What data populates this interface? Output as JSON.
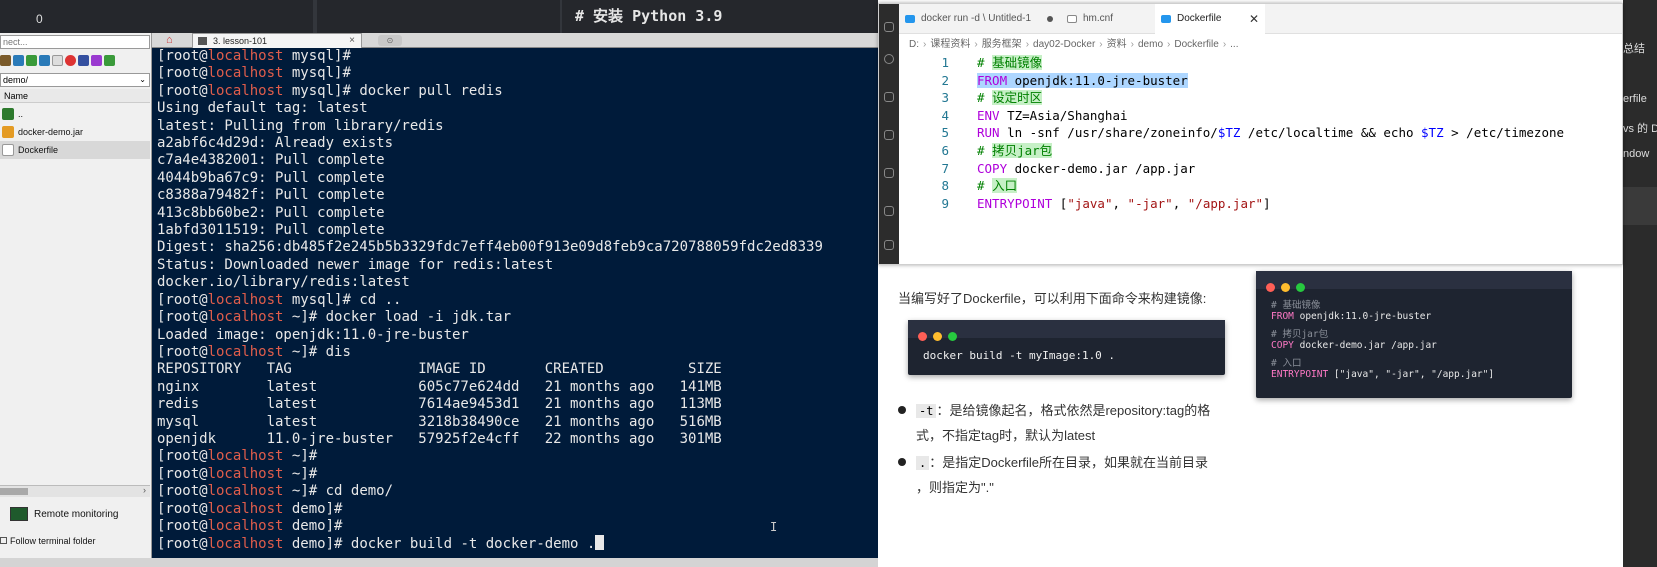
{
  "topbar": {
    "left_text": "0",
    "python_heading": "# 安装 Python 3.9"
  },
  "file_panel": {
    "search_placeholder": "nect...",
    "path": "demo/",
    "column_name": "Name",
    "files": [
      "..",
      "docker-demo.jar",
      "Dockerfile"
    ],
    "remote_monitoring": "Remote monitoring",
    "follow_terminal": "Follow terminal folder"
  },
  "terminal_tabs": {
    "tab_label": "3. lesson-101",
    "close": "×"
  },
  "terminal": {
    "lines": [
      {
        "host": "localhost",
        "dir": "mysql",
        "cmd": ""
      },
      {
        "host": "localhost",
        "dir": "mysql",
        "cmd": ""
      },
      {
        "host": "localhost",
        "dir": "mysql",
        "cmd": "docker pull redis"
      },
      {
        "out": "Using default tag: latest"
      },
      {
        "out": "latest: Pulling from library/redis"
      },
      {
        "out": "a2abf6c4d29d: Already exists"
      },
      {
        "out": "c7a4e4382001: Pull complete"
      },
      {
        "out": "4044b9ba67c9: Pull complete"
      },
      {
        "out": "c8388a79482f: Pull complete"
      },
      {
        "out": "413c8bb60be2: Pull complete"
      },
      {
        "out": "1abfd3011519: Pull complete"
      },
      {
        "out": "Digest: sha256:db485f2e245b5b3329fdc7eff4eb00f913e09d8feb9ca720788059fdc2ed8339"
      },
      {
        "out": "Status: Downloaded newer image for redis:latest"
      },
      {
        "out": "docker.io/library/redis:latest"
      },
      {
        "host": "localhost",
        "dir": "mysql",
        "cmd": "cd .."
      },
      {
        "host": "localhost",
        "dir": "~",
        "cmd": "docker load -i jdk.tar"
      },
      {
        "out": "Loaded image: openjdk:11.0-jre-buster"
      },
      {
        "host": "localhost",
        "dir": "~",
        "cmd": "dis"
      },
      {
        "out": "REPOSITORY   TAG               IMAGE ID       CREATED          SIZE"
      },
      {
        "out": "nginx        latest            605c77e624dd   21 months ago   141MB"
      },
      {
        "out": "redis        latest            7614ae9453d1   21 months ago   113MB"
      },
      {
        "out": "mysql        latest            3218b38490ce   21 months ago   516MB"
      },
      {
        "out": "openjdk      11.0-jre-buster   57925f2e4cff   22 months ago   301MB"
      },
      {
        "host": "localhost",
        "dir": "~",
        "cmd": ""
      },
      {
        "host": "localhost",
        "dir": "~",
        "cmd": ""
      },
      {
        "host": "localhost",
        "dir": "~",
        "cmd": "cd demo/"
      },
      {
        "host": "localhost",
        "dir": "demo",
        "cmd": ""
      },
      {
        "host": "localhost",
        "dir": "demo",
        "cmd": ""
      },
      {
        "host": "localhost",
        "dir": "demo",
        "cmd": "docker build -t docker-demo .",
        "cursor": true
      }
    ]
  },
  "vscode": {
    "tabs": [
      {
        "label": "docker run -d \\ Untitled-1",
        "state": "dirty"
      },
      {
        "label": "hm.cnf",
        "state": "normal"
      },
      {
        "label": "Dockerfile",
        "state": "active"
      }
    ],
    "breadcrumbs": [
      "D:",
      "课程资料",
      "服务框架",
      "day02-Docker",
      "资料",
      "demo",
      "Dockerfile",
      "..."
    ],
    "line_numbers": [
      "1",
      "2",
      "3",
      "4",
      "5",
      "6",
      "7",
      "8",
      "9"
    ]
  },
  "doc": {
    "intro": "当编写好了Dockerfile，可以利用下面命令来构建镜像:",
    "command": "docker build -t myImage:1.0 .",
    "bullet1_code": "-t",
    "bullet1_line1": "：是给镜像起名，格式依然是repository:tag的格",
    "bullet1_line2": "式，不指定tag时，默认为latest",
    "bullet2_code": ".",
    "bullet2_line1": "：是指定Dockerfile所在目录，如果就在当前目录",
    "bullet2_line2": "，则指定为\".\""
  },
  "image_card": {
    "lines": [
      {
        "t": "# 基础镜像",
        "kind": "comment"
      },
      {
        "kw": "FROM",
        "t": " openjdk:11.0-jre-buster"
      },
      {
        "t": "# 拷贝jar包",
        "kind": "comment"
      },
      {
        "kw": "COPY",
        "t": " docker-demo.jar /app.jar"
      },
      {
        "t": "# 入口",
        "kind": "comment"
      },
      {
        "kw": "ENTRYPOINT",
        "t": " [\"java\", \"-jar\", \"/app.jar\"]"
      }
    ]
  },
  "right_edge_texts": [
    "总结",
    "erfile",
    "vs 的 D",
    "ndow"
  ],
  "colors": {
    "terminal_bg": "#001b3a",
    "prompt_host": "#e05d4b",
    "vscode_keyword": "#af00db",
    "vscode_comment": "#008000"
  }
}
